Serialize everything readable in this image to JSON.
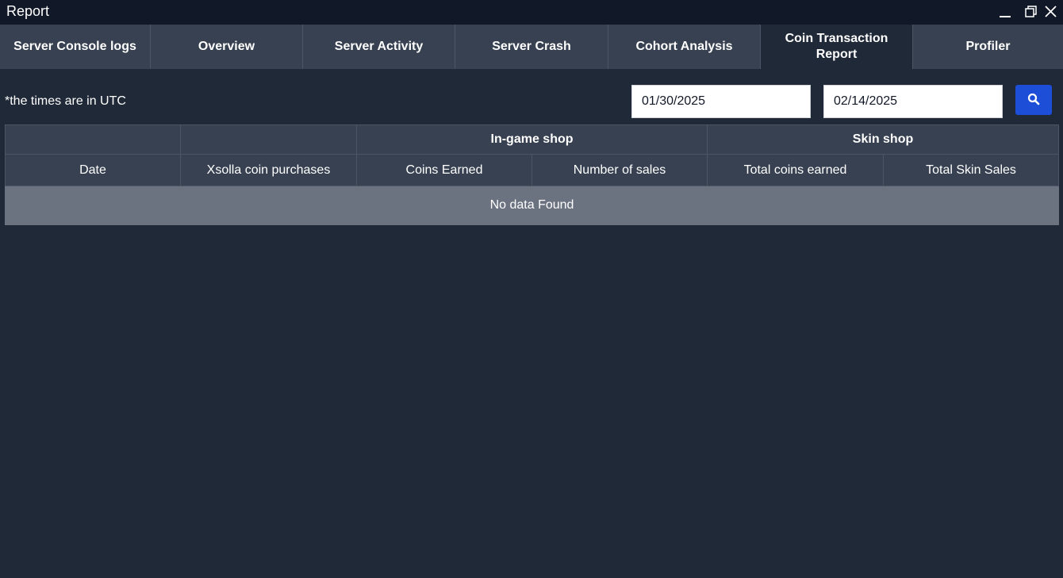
{
  "window": {
    "title": "Report",
    "controls": [
      {
        "name": "minimize-icon"
      },
      {
        "name": "restore-icon"
      },
      {
        "name": "close-icon"
      }
    ]
  },
  "tabs": [
    {
      "label": "Server Console logs",
      "active": false
    },
    {
      "label": "Overview",
      "active": false
    },
    {
      "label": "Server Activity",
      "active": false
    },
    {
      "label": "Server Crash",
      "active": false
    },
    {
      "label": "Cohort Analysis",
      "active": false
    },
    {
      "label": "Coin Transaction Report",
      "active": true
    },
    {
      "label": "Profiler",
      "active": false
    }
  ],
  "filters": {
    "note": "*the times are in UTC",
    "start_date": "01/30/2025",
    "end_date": "02/14/2025",
    "search_icon": "search-icon",
    "search_button_color": "#1d4ed8"
  },
  "table": {
    "groups": [
      "",
      "",
      "In-game shop",
      "Skin shop"
    ],
    "columns": [
      "Date",
      "Xsolla coin purchases",
      "Coins Earned",
      "Number of sales",
      "Total coins earned",
      "Total Skin Sales"
    ],
    "empty_message": "No data Found"
  },
  "colors": {
    "background": "#202938",
    "titlebar": "#111827",
    "tab_bg": "#374151",
    "empty_row": "#6b7280"
  }
}
